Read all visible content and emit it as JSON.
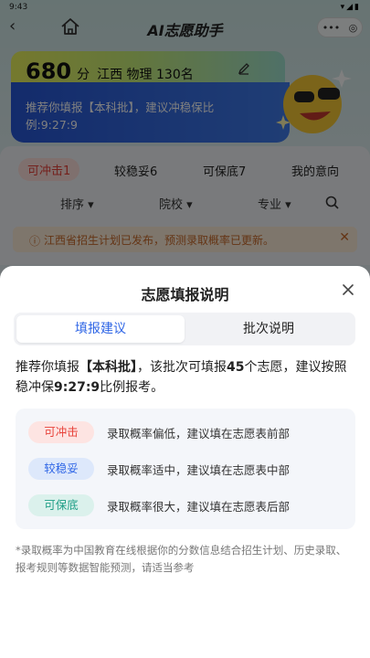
{
  "status_bar": {
    "time": "9:43",
    "signal": "▾◢▮"
  },
  "nav": {
    "back_glyph": "‹",
    "title": "AI志愿助手",
    "more_glyph": "•••",
    "target_glyph": "◎"
  },
  "score_card": {
    "score": "680",
    "unit": "分",
    "info": "江西 物理 130名",
    "recommendation": "推荐你填报【本科批】，建议冲稳保比例:9:27:9"
  },
  "category_tabs": [
    {
      "label": "可冲击1"
    },
    {
      "label": "较稳妥6"
    },
    {
      "label": "可保底7"
    },
    {
      "label": "我的意向"
    }
  ],
  "filters": [
    {
      "label": "排序"
    },
    {
      "label": "院校"
    },
    {
      "label": "专业"
    }
  ],
  "notice": {
    "text": "江西省招生计划已发布，预测录取概率已更新。",
    "icon_glyph": "ⓘ",
    "close_glyph": "✕"
  },
  "sheet": {
    "title": "志愿填报说明",
    "tabs": [
      {
        "label": "填报建议",
        "active": true
      },
      {
        "label": "批次说明",
        "active": false
      }
    ],
    "description_prefix": "推荐你填报",
    "description_batch": "【本科批】",
    "description_mid": "，该批次可填报",
    "description_count": "45",
    "description_suffix": "个志愿，建议按照稳冲保",
    "description_ratio": "9:27:9",
    "description_end": "比例报考。",
    "legend": [
      {
        "badge": "可冲击",
        "text": "录取概率偏低，建议填在志愿表前部",
        "bg": "#fde4e2",
        "fg": "#e8433b"
      },
      {
        "badge": "较稳妥",
        "text": "录取概率适中，建议填在志愿表中部",
        "bg": "#dde8fb",
        "fg": "#2f66e6"
      },
      {
        "badge": "可保底",
        "text": "录取概率很大，建议填在志愿表后部",
        "bg": "#dbf1ec",
        "fg": "#1f9e86"
      }
    ],
    "footnote": "*录取概率为中国教育在线根据你的分数信息结合招生计划、历史录取、报考规则等数据智能预测，请适当参考"
  },
  "colors": {
    "accent_blue": "#2f66e6",
    "accent_red": "#e8433b",
    "accent_teal": "#1f9e86"
  },
  "icons": [
    "home-icon",
    "edit-icon",
    "search-icon",
    "close-icon",
    "info-icon",
    "chevron-down-icon"
  ]
}
